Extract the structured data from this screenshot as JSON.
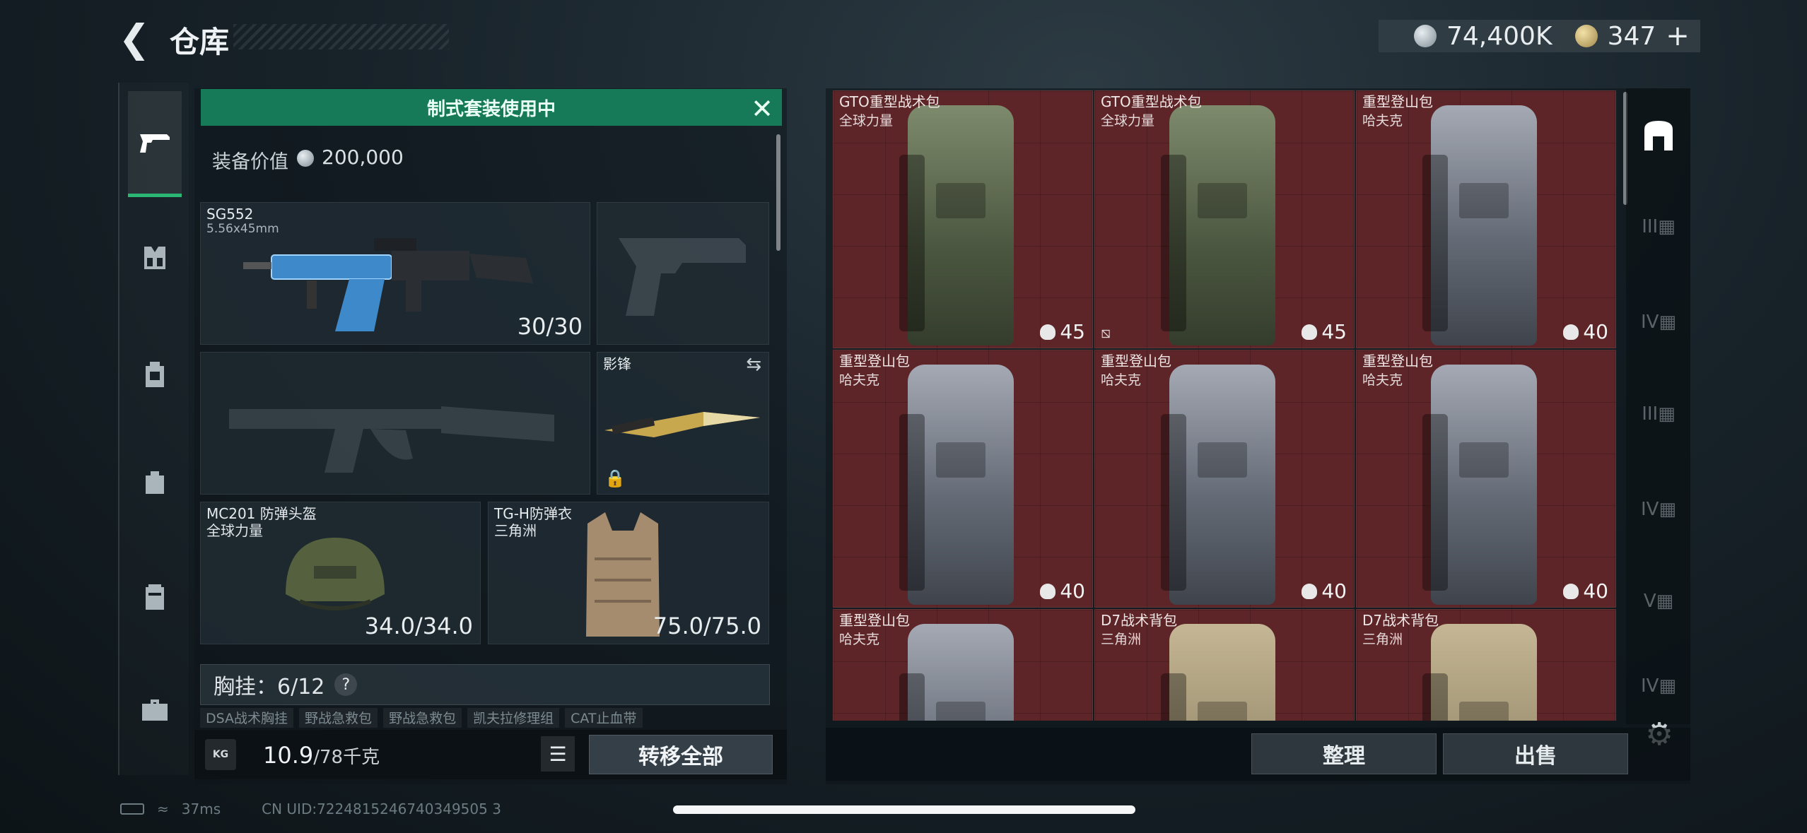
{
  "header": {
    "title": "仓库"
  },
  "currency": {
    "silver": "74,400K",
    "gold": "347",
    "gold_plus": "+"
  },
  "loadout": {
    "suit_banner": "制式套装使用中",
    "equip_value_label": "装备价值",
    "equip_value": "200,000",
    "primary": {
      "name": "SG552",
      "caliber": "5.56x45mm",
      "ammo": "30/30"
    },
    "knife": {
      "name": "影锋"
    },
    "helmet": {
      "name": "MC201 防弹头盔",
      "brand": "全球力量",
      "durability": "34.0/34.0"
    },
    "armor": {
      "name": "TG-H防弹衣",
      "brand": "三角洲",
      "durability": "75.0/75.0"
    },
    "chest_rig_label": "胸挂：6/12",
    "chest_help": "?",
    "rig_items": [
      "DSA战术胸挂",
      "野战急救包",
      "野战急救包",
      "凯夫拉修理组",
      "CAT止血带"
    ],
    "weight": "10.9",
    "weight_max": "/78千克",
    "kg_icon": "KG",
    "transfer_all": "转移全部"
  },
  "storage": {
    "items": [
      {
        "name": "GTO重型战术包",
        "brand": "全球力量",
        "capacity": "45",
        "color": "green"
      },
      {
        "name": "GTO重型战术包",
        "brand": "全球力量",
        "capacity": "45",
        "color": "green"
      },
      {
        "name": "重型登山包",
        "brand": "哈夫克",
        "capacity": "40",
        "color": "grey"
      },
      {
        "name": "重型登山包",
        "brand": "哈夫克",
        "capacity": "40",
        "color": "grey"
      },
      {
        "name": "重型登山包",
        "brand": "哈夫克",
        "capacity": "40",
        "color": "grey"
      },
      {
        "name": "重型登山包",
        "brand": "哈夫克",
        "capacity": "40",
        "color": "grey"
      },
      {
        "name": "重型登山包",
        "brand": "哈夫克",
        "capacity": "",
        "color": "grey"
      },
      {
        "name": "D7战术背包",
        "brand": "三角洲",
        "capacity": "",
        "color": "tan"
      },
      {
        "name": "D7战术背包",
        "brand": "三角洲",
        "capacity": "",
        "color": "tan"
      }
    ],
    "sort_label": "整理",
    "sell_label": "出售"
  },
  "right_filters": [
    "III",
    "IV",
    "III",
    "IV",
    "V",
    "IV"
  ],
  "status": {
    "ping": "37ms",
    "uid": "CN UID:7224815246740349505 3"
  },
  "icons": {
    "back": "chevron-left-icon",
    "pistol": "pistol-icon",
    "settings": "gear-icon"
  },
  "colors": {
    "accent_green": "#167a58",
    "cell_red": "#5d2528"
  }
}
